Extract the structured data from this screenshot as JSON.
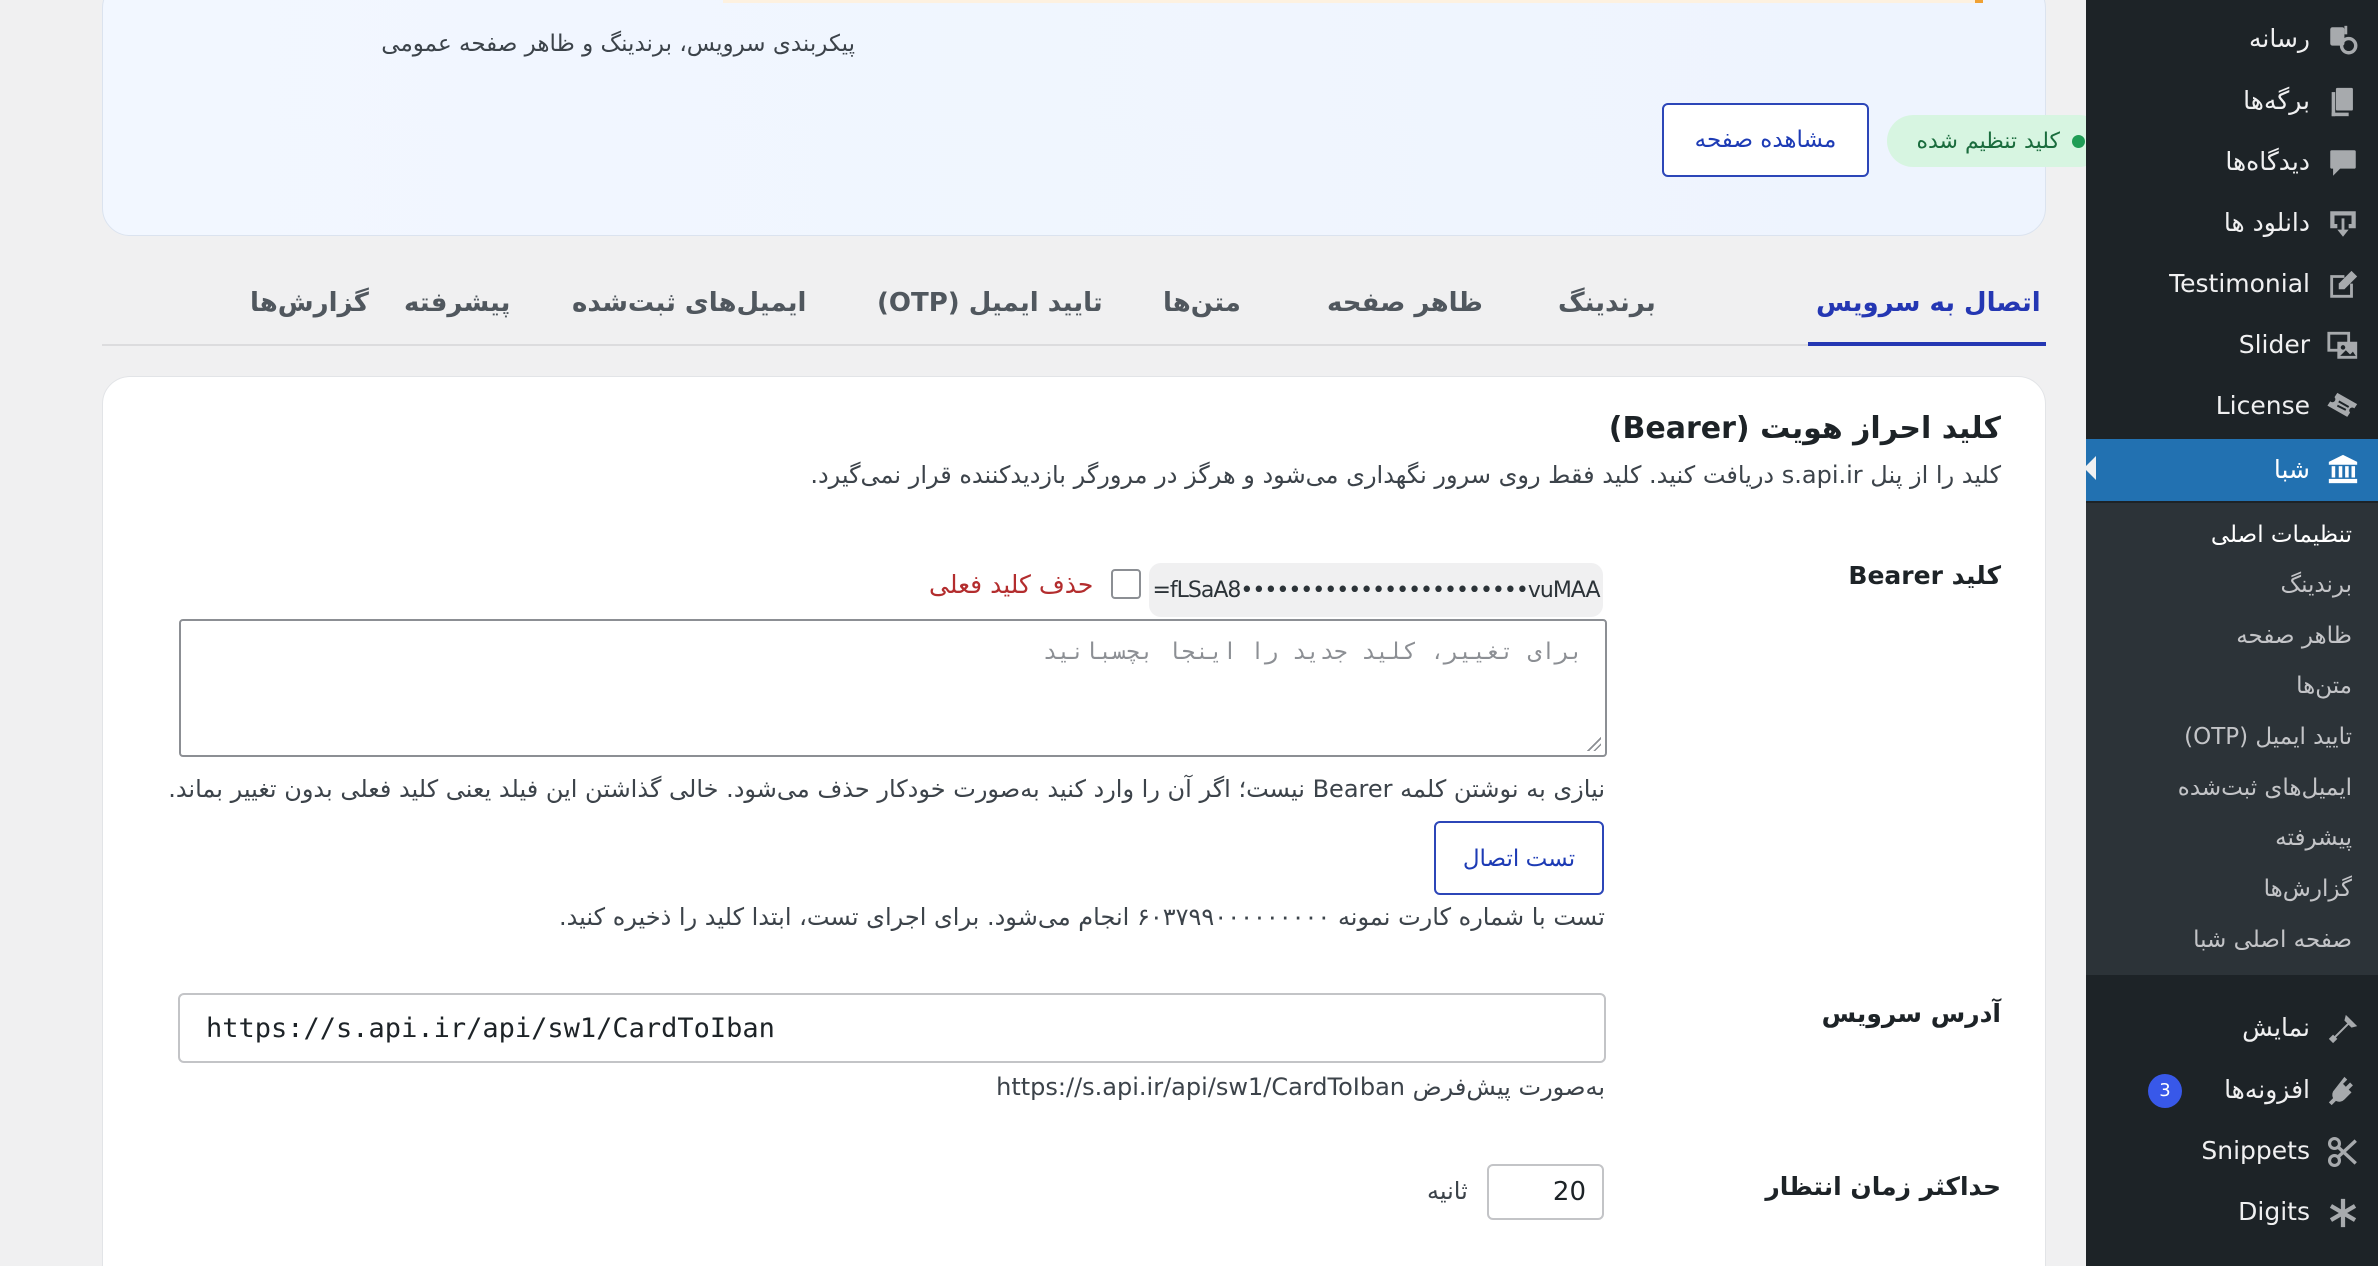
{
  "sidebar": {
    "items": [
      {
        "label": "رسانه",
        "icon": "media-icon"
      },
      {
        "label": "برگه‌ها",
        "icon": "pages-icon"
      },
      {
        "label": "دیدگاه‌ها",
        "icon": "comments-icon"
      },
      {
        "label": "دانلود ها",
        "icon": "download-icon"
      },
      {
        "label": "Testimonial",
        "icon": "edit-icon"
      },
      {
        "label": "Slider",
        "icon": "images-icon"
      },
      {
        "label": "License",
        "icon": "ticket-icon"
      },
      {
        "label": "شبا",
        "icon": "bank-icon",
        "current": true
      },
      {
        "label": "نمایش",
        "icon": "appearance-icon"
      },
      {
        "label": "افزونه‌ها",
        "icon": "plugins-icon",
        "badge": "3"
      },
      {
        "label": "Snippets",
        "icon": "scissors-icon"
      },
      {
        "label": "Digits",
        "icon": "asterisk-icon"
      }
    ],
    "submenu": [
      "تنظیمات اصلی",
      "برندینگ",
      "ظاهر صفحه",
      "متن‌ها",
      "تایید ایمیل (OTP)",
      "ایمیل‌های ثبت‌شده",
      "پیشرفته",
      "گزارش‌ها",
      "صفحه اصلی شبا"
    ]
  },
  "hero": {
    "subtitle": "پیکربندی سرویس، برندینگ و ظاهر صفحه عمومی",
    "status": "کلید تنظیم شده",
    "view_button": "مشاهده صفحه"
  },
  "tabs": [
    "اتصال به سرویس",
    "برندینگ",
    "ظاهر صفحه",
    "متن‌ها",
    "تایید ایمیل (OTP)",
    "ایمیل‌های ثبت‌شده",
    "پیشرفته",
    "گزارش‌ها"
  ],
  "connection": {
    "title": "کلید احراز هویت (Bearer)",
    "description": "کلید را از پنل s.api.ir دریافت کنید. کلید فقط روی سرور نگهداری می‌شود و هرگز در مرورگر بازدیدکننده قرار نمی‌گیرد.",
    "bearer_label": "کلید Bearer",
    "masked_key": "=fLSaA8••••••••••••••••••••••••vuMAA",
    "remove_label": "حذف کلید فعلی",
    "new_key_placeholder": "برای تغییر، کلید جدید را اینجا بچسبانید",
    "key_help": "نیازی به نوشتن کلمه Bearer نیست؛ اگر آن را وارد کنید به‌صورت خودکار حذف می‌شود. خالی گذاشتن این فیلد یعنی کلید فعلی بدون تغییر بماند.",
    "test_button": "تست اتصال",
    "test_help": "تست با شماره کارت نمونه ۶۰۳۷۹۹۰۰۰۰۰۰۰۰۰ انجام می‌شود. برای اجرای تست، ابتدا کلید را ذخیره کنید.",
    "service_url_label": "آدرس سرویس",
    "service_url_value": "https://s.api.ir/api/sw1/CardToIban",
    "service_url_help": "به‌صورت پیش‌فرض https://s.api.ir/api/sw1/CardToIban",
    "timeout_label": "حداکثر زمان انتظار",
    "timeout_value": "20",
    "timeout_unit": "ثانیه"
  },
  "colors": {
    "sidebar_bg": "#1d2327",
    "sidebar_current": "#2271b1",
    "accent": "#2437b3",
    "status_green": "#1f9d55",
    "danger": "#b32d2e"
  }
}
